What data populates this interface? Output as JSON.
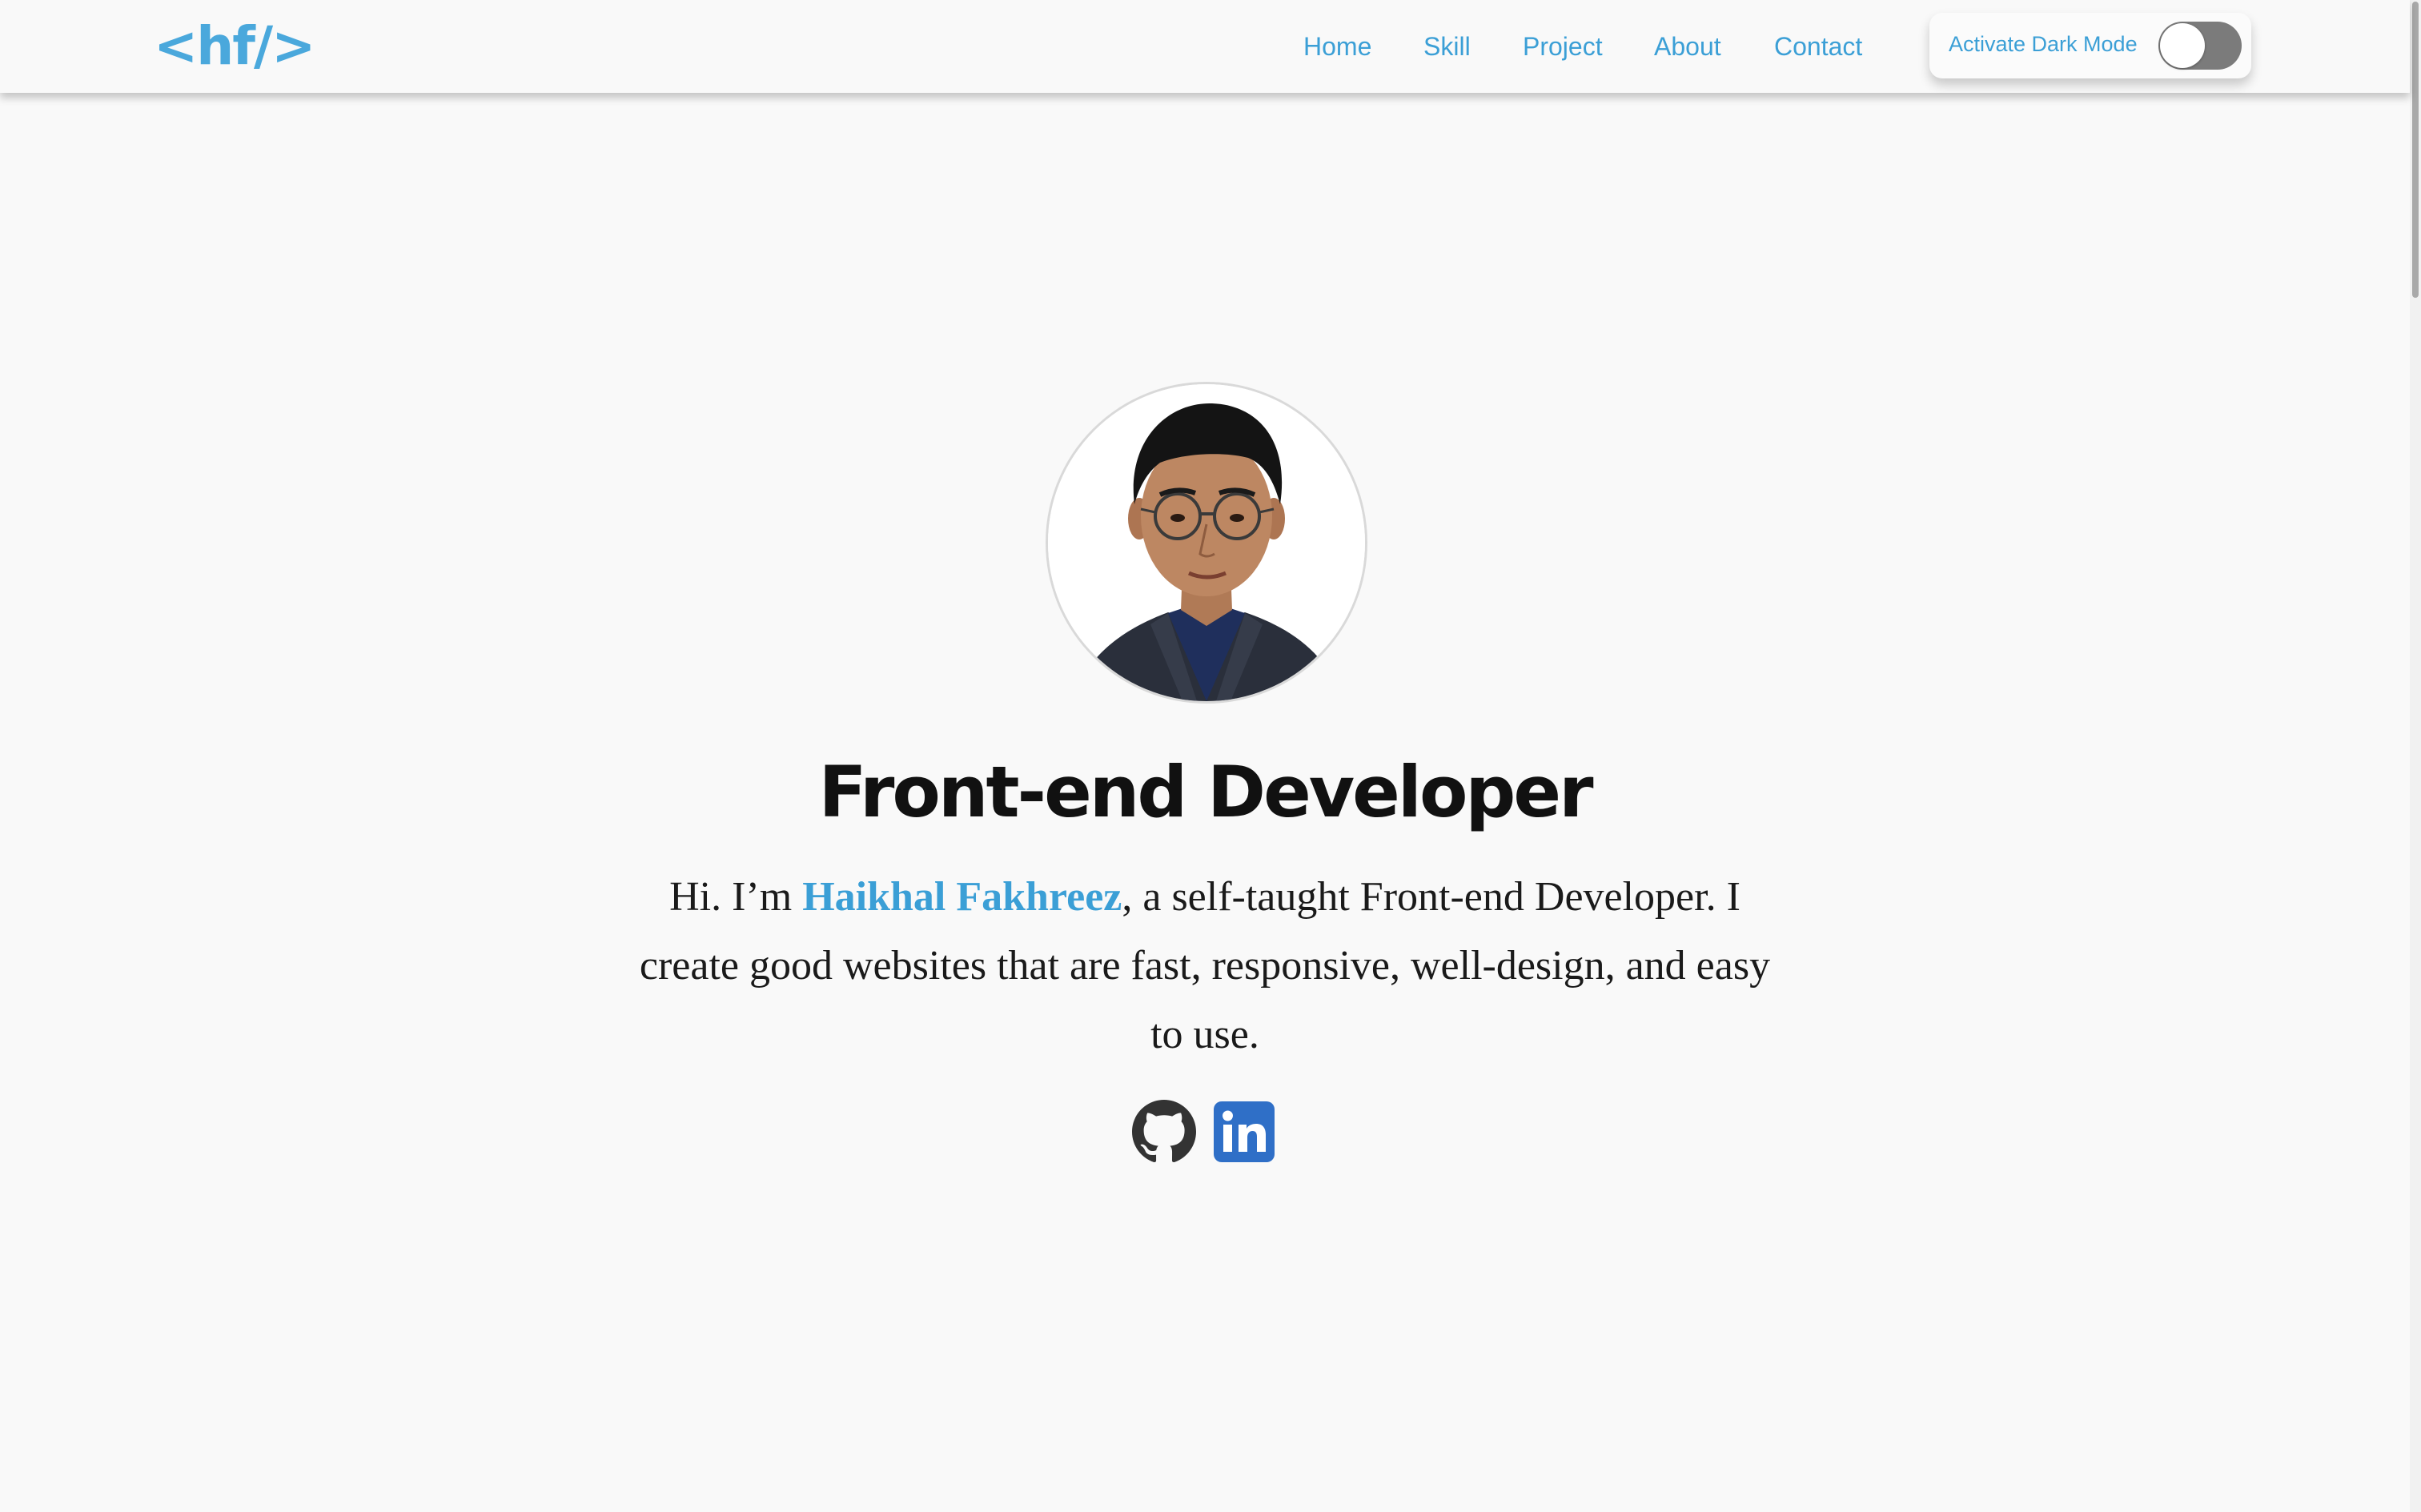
{
  "header": {
    "logo": "<hf/>",
    "nav": [
      {
        "label": "Home"
      },
      {
        "label": "Skill"
      },
      {
        "label": "Project"
      },
      {
        "label": "About"
      },
      {
        "label": "Contact"
      }
    ],
    "dark_mode": {
      "label": "Activate Dark Mode",
      "enabled": false
    }
  },
  "hero": {
    "avatar_icon": "profile-photo",
    "title": "Front-end Developer",
    "intro_prefix": "Hi. I’m ",
    "name": "Haikhal Fakhreez",
    "intro_suffix": ", a self-taught Front-end Developer. I create good websites that are fast, responsive, well-design, and easy to use.",
    "socials": [
      {
        "icon": "github-icon"
      },
      {
        "icon": "linkedin-icon"
      }
    ]
  },
  "colors": {
    "accent": "#3b9fd6",
    "background": "#f9f9f9",
    "text": "#111111",
    "linkedin": "#2f6fc7"
  }
}
